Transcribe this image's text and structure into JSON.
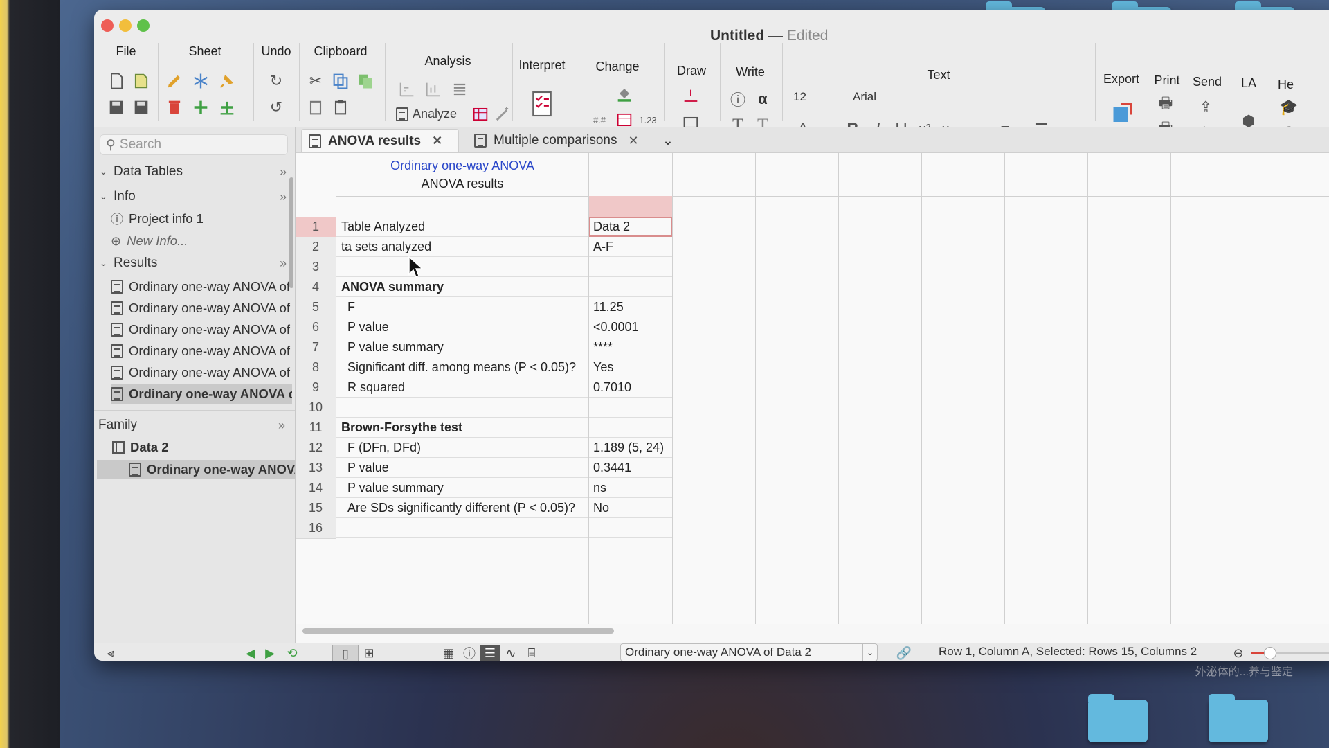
{
  "window": {
    "title": "Untitled",
    "title_sep": "—",
    "status": "Edited"
  },
  "toolbar": {
    "groups": [
      "File",
      "Sheet",
      "Undo",
      "Clipboard",
      "Analysis",
      "Interpret",
      "Change",
      "Draw",
      "Write",
      "Text",
      "Export",
      "Print",
      "Send",
      "LA",
      "He"
    ],
    "analyze_label": "Analyze",
    "font_size": "12",
    "font_name": "Arial"
  },
  "sidebar": {
    "search_placeholder": "Search",
    "sections": {
      "data_tables": "Data Tables",
      "info": "Info",
      "results": "Results",
      "family": "Family"
    },
    "info_items": [
      "Project info 1",
      "New Info..."
    ],
    "result_items": [
      "Ordinary one-way ANOVA of Dat",
      "Ordinary one-way ANOVA of Dat",
      "Ordinary one-way ANOVA of Dat",
      "Ordinary one-way ANOVA of Dat",
      "Ordinary one-way ANOVA of Dat",
      "Ordinary one-way ANOVA of Da"
    ],
    "family_items": [
      "Data 2",
      "Ordinary one-way ANOVA"
    ]
  },
  "tabs": [
    "ANOVA results",
    "Multiple comparisons"
  ],
  "sheet": {
    "header_title": "Ordinary one-way ANOVA",
    "header_subtitle": "ANOVA results",
    "rows": [
      {
        "n": "1",
        "label": "Table Analyzed",
        "value": "Data 2",
        "style": "plain"
      },
      {
        "n": "2",
        "label": "ta sets analyzed",
        "value": "A-F",
        "style": "plain"
      },
      {
        "n": "3",
        "label": "",
        "value": "",
        "style": "plain"
      },
      {
        "n": "4",
        "label": "ANOVA summary",
        "value": "",
        "style": "bold"
      },
      {
        "n": "5",
        "label": "F",
        "value": "11.25",
        "style": "ind"
      },
      {
        "n": "6",
        "label": "P value",
        "value": "<0.0001",
        "style": "ind"
      },
      {
        "n": "7",
        "label": "P value summary",
        "value": "****",
        "style": "ind"
      },
      {
        "n": "8",
        "label": "Significant diff. among means (P < 0.05)?",
        "value": "Yes",
        "style": "ind"
      },
      {
        "n": "9",
        "label": "R squared",
        "value": "0.7010",
        "style": "ind"
      },
      {
        "n": "10",
        "label": "",
        "value": "",
        "style": "plain"
      },
      {
        "n": "11",
        "label": "Brown-Forsythe test",
        "value": "",
        "style": "bold"
      },
      {
        "n": "12",
        "label": "F (DFn, DFd)",
        "value": "1.189 (5, 24)",
        "style": "ind"
      },
      {
        "n": "13",
        "label": "P value",
        "value": "0.3441",
        "style": "ind"
      },
      {
        "n": "14",
        "label": "P value summary",
        "value": "ns",
        "style": "ind"
      },
      {
        "n": "15",
        "label": "Are SDs significantly different (P < 0.05)?",
        "value": "No",
        "style": "ind"
      },
      {
        "n": "16",
        "label": "",
        "value": "",
        "style": "plain"
      }
    ]
  },
  "statusbar": {
    "sheet_select": "Ordinary one-way ANOVA of Data 2",
    "status_text": "Row 1, Column A, Selected: Rows 15, Columns 2"
  },
  "desktop_caption": "外泌体的...养与鉴定",
  "colors": {
    "accent_link": "#2a47c9",
    "selection_red": "#d98d8d",
    "folder": "#63b9de"
  }
}
